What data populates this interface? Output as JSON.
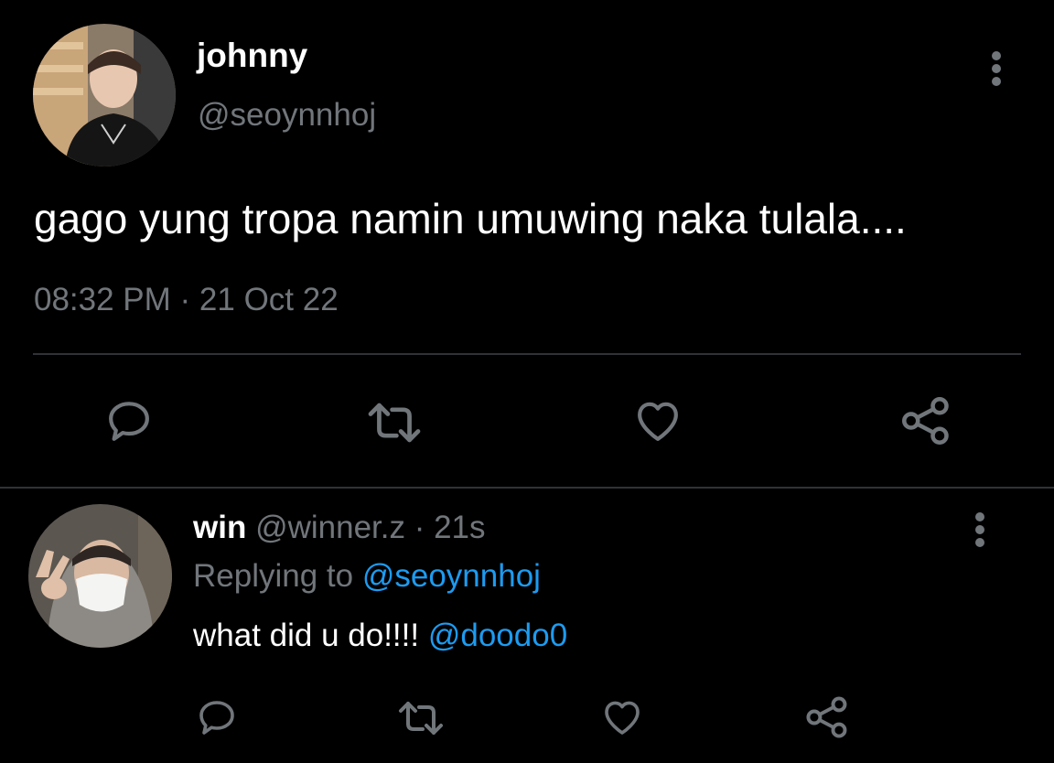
{
  "main_tweet": {
    "name": "johnny",
    "handle": "@seoynnhoj",
    "text": "gago yung tropa namin umuwing naka tulala....",
    "timestamp": "08:32 PM · 21 Oct 22",
    "actions": [
      "reply-icon",
      "retweet-icon",
      "like-icon",
      "share-icon"
    ]
  },
  "reply": {
    "name": "win",
    "handle_time": "@winner.z · 21s",
    "replying_label": "Replying to",
    "replying_handle": "@seoynnhoj",
    "text": "what did u do!!!!",
    "mention": "@doodo0",
    "actions": [
      "reply-icon",
      "retweet-icon",
      "like-icon",
      "share-icon"
    ]
  },
  "colors": {
    "background": "#000000",
    "primary_text": "#ffffff",
    "secondary_text": "#71767b",
    "accent": "#1d9bf0",
    "divider": "#2f3336"
  }
}
